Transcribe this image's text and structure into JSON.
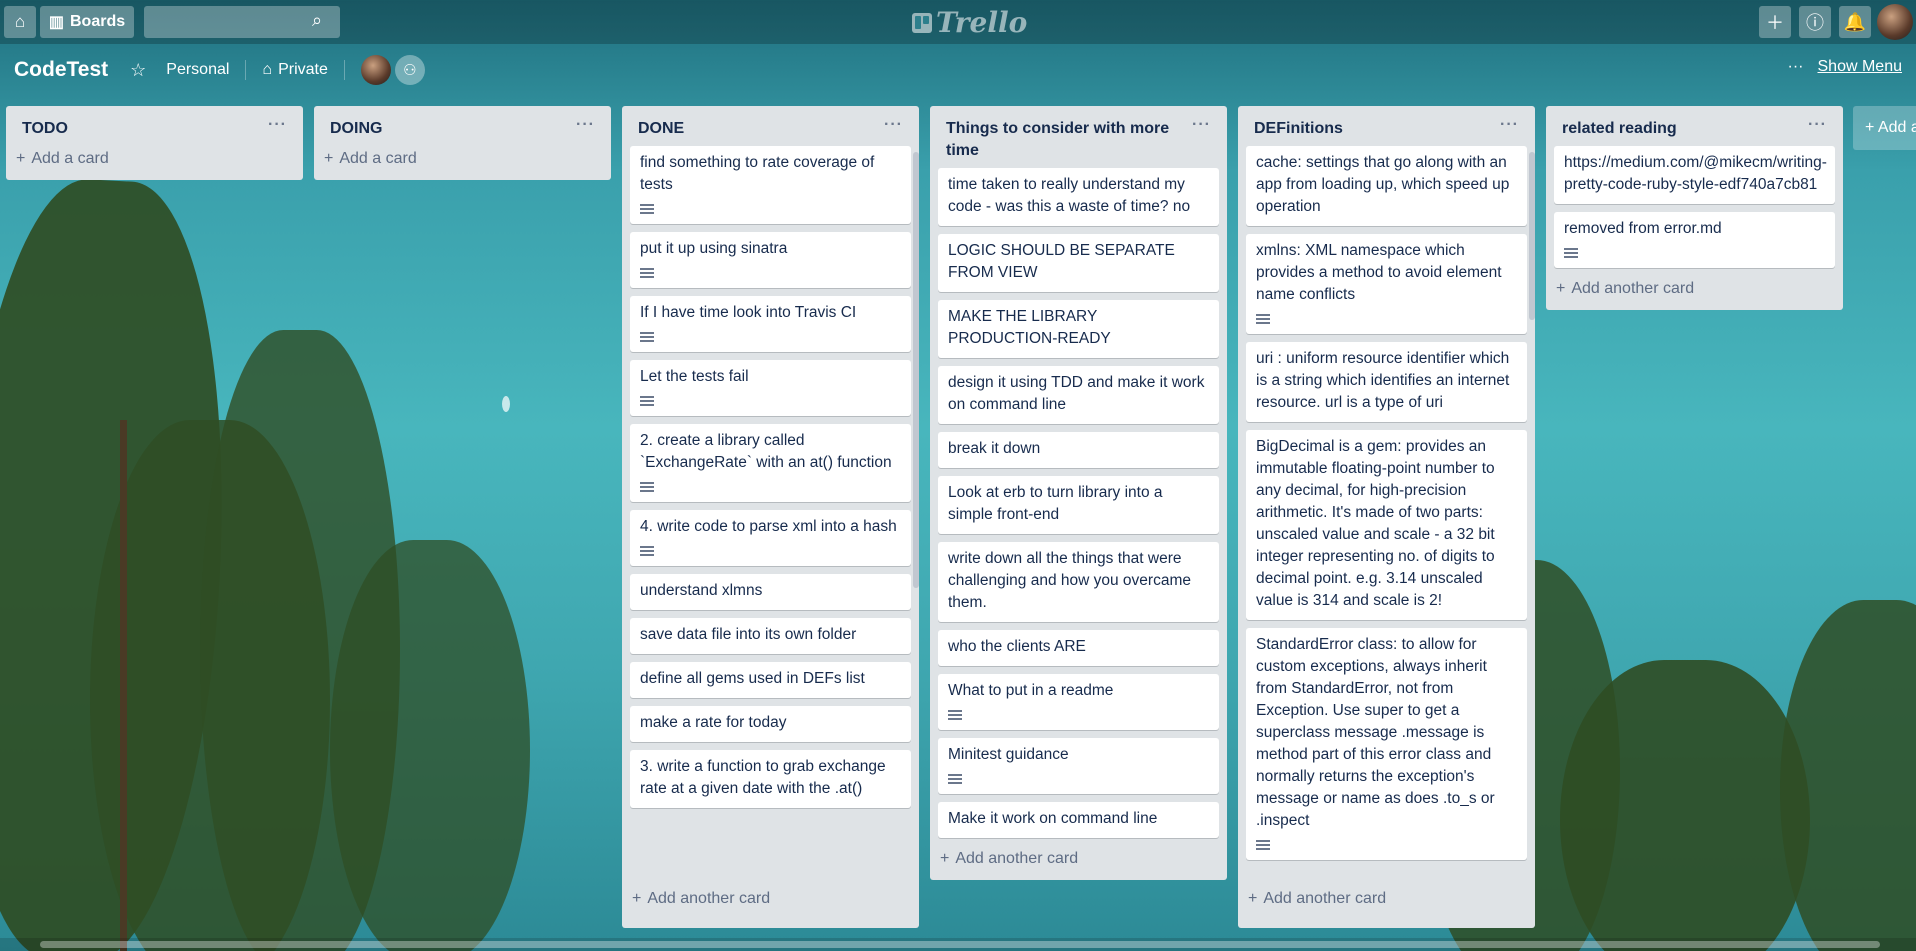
{
  "header": {
    "boards_label": "Boards",
    "logo_text": "Trello",
    "search_placeholder": ""
  },
  "board": {
    "name": "CodeTest",
    "team": "Personal",
    "visibility": "Private",
    "show_menu": "Show Menu",
    "more": "···"
  },
  "add_list_label": "+ Add another list",
  "lists": [
    {
      "title": "TODO",
      "cards": [],
      "add_label": "Add a card"
    },
    {
      "title": "DOING",
      "cards": [],
      "add_label": "Add a card"
    },
    {
      "title": "DONE",
      "add_label": "Add another card",
      "cards": [
        {
          "text": "find something to rate coverage of tests",
          "desc": true
        },
        {
          "text": "put it up using sinatra",
          "desc": true
        },
        {
          "text": "If I have time look into Travis CI",
          "desc": true
        },
        {
          "text": "Let the tests fail",
          "desc": true
        },
        {
          "text": "2. create a library called `ExchangeRate` with an at() function",
          "desc": true
        },
        {
          "text": "4. write code to parse xml into a hash",
          "desc": true
        },
        {
          "text": "understand xlmns",
          "desc": false
        },
        {
          "text": "save data file into its own folder",
          "desc": false
        },
        {
          "text": "define all gems used in DEFs list",
          "desc": false
        },
        {
          "text": "make a rate for today",
          "desc": false
        },
        {
          "text": "3. write a function to grab exchange rate at a given date with the .at()",
          "desc": false
        }
      ]
    },
    {
      "title": "Things to consider with more time",
      "add_label": "Add another card",
      "cards": [
        {
          "text": "time taken to really understand my code - was this a waste of time? no",
          "desc": false
        },
        {
          "text": "LOGIC SHOULD BE SEPARATE FROM VIEW",
          "desc": false
        },
        {
          "text": "MAKE THE LIBRARY PRODUCTION-READY",
          "desc": false
        },
        {
          "text": "design it using TDD and make it work on command line",
          "desc": false
        },
        {
          "text": "break it down",
          "desc": false
        },
        {
          "text": "Look at erb to turn library into a simple front-end",
          "desc": false
        },
        {
          "text": "write down all the things that were challenging and how you overcame them.",
          "desc": false
        },
        {
          "text": "who the clients ARE",
          "desc": false
        },
        {
          "text": "What to put in a readme",
          "desc": true
        },
        {
          "text": "Minitest guidance",
          "desc": true
        },
        {
          "text": "Make it work on command line",
          "desc": false
        }
      ]
    },
    {
      "title": "DEFinitions",
      "add_label": "Add another card",
      "cards": [
        {
          "text": "cache: settings that go along with an app from loading up, which speed up operation",
          "desc": false
        },
        {
          "text": "xmlns: XML namespace which provides a method to avoid element name conflicts",
          "desc": true
        },
        {
          "text": "uri : uniform resource identifier which is a string which identifies an internet resource. url is a type of uri",
          "desc": false
        },
        {
          "text": "BigDecimal is a gem: provides an immutable floating-point number to any decimal, for high-precision arithmetic. It's made of two parts: unscaled value and scale - a 32 bit integer representing no. of digits to decimal point. e.g. 3.14 unscaled value is 314 and scale is 2!",
          "desc": false
        },
        {
          "text": "StandardError class: to allow for custom exceptions, always inherit from StandardError, not from Exception. Use super to get a superclass message .message is method part of this error class and normally returns the exception's message or name as does .to_s or .inspect",
          "desc": true
        }
      ]
    },
    {
      "title": "related reading",
      "add_label": "Add another card",
      "cards": [
        {
          "text": "https://medium.com/@mikecm/writing-pretty-code-ruby-style-edf740a7cb81",
          "desc": false
        },
        {
          "text": "removed from error.md",
          "desc": true
        }
      ]
    }
  ]
}
